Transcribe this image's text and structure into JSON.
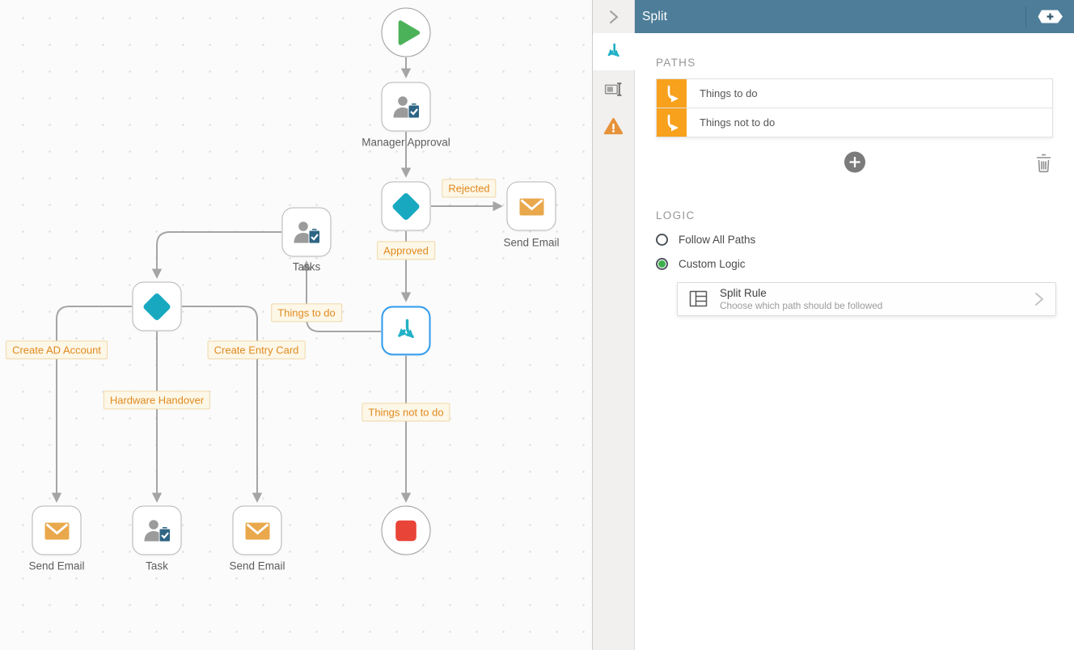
{
  "colors": {
    "panel_header": "#4d7d98",
    "accent_teal": "#1fadc4",
    "accent_orange": "#f7a11c",
    "badge_text_orange": "#e08a1e",
    "selected_node_blue": "#2e9bef",
    "start_green": "#4cb25a",
    "end_red": "#e94438",
    "radio_green": "#3cb04c",
    "connector_gray": "#a5a5a5"
  },
  "canvas": {
    "nodes": [
      {
        "id": "start",
        "type": "start-event",
        "label": ""
      },
      {
        "id": "manager-approval",
        "type": "user-task",
        "label": "Manager Approval"
      },
      {
        "id": "decision-approval",
        "type": "decision",
        "label": ""
      },
      {
        "id": "send-email-rejected",
        "type": "send-email",
        "label": "Send Email"
      },
      {
        "id": "tasks",
        "type": "user-task",
        "label": "Tasks"
      },
      {
        "id": "split",
        "type": "split",
        "label": "",
        "selected": true
      },
      {
        "id": "decision-things-to-do",
        "type": "decision",
        "label": ""
      },
      {
        "id": "send-email-ad-account",
        "type": "send-email",
        "label": "Send Email"
      },
      {
        "id": "task-hardware",
        "type": "user-task",
        "label": "Task"
      },
      {
        "id": "send-email-entry-card",
        "type": "send-email",
        "label": "Send Email"
      },
      {
        "id": "end",
        "type": "end-event",
        "label": ""
      }
    ],
    "edge_labels": [
      "Rejected",
      "Approved",
      "Things to do",
      "Create AD Account",
      "Hardware Handover",
      "Create Entry Card",
      "Things not to do"
    ]
  },
  "panel": {
    "header": {
      "title": "Split"
    },
    "paths": {
      "heading": "PATHS",
      "items": [
        {
          "label": "Things to do"
        },
        {
          "label": "Things not to do"
        }
      ]
    },
    "logic": {
      "heading": "LOGIC",
      "options": [
        {
          "label": "Follow All Paths",
          "selected": false
        },
        {
          "label": "Custom Logic",
          "selected": true
        }
      ],
      "rule": {
        "title": "Split Rule",
        "subtitle": "Choose which path should be followed"
      }
    }
  }
}
